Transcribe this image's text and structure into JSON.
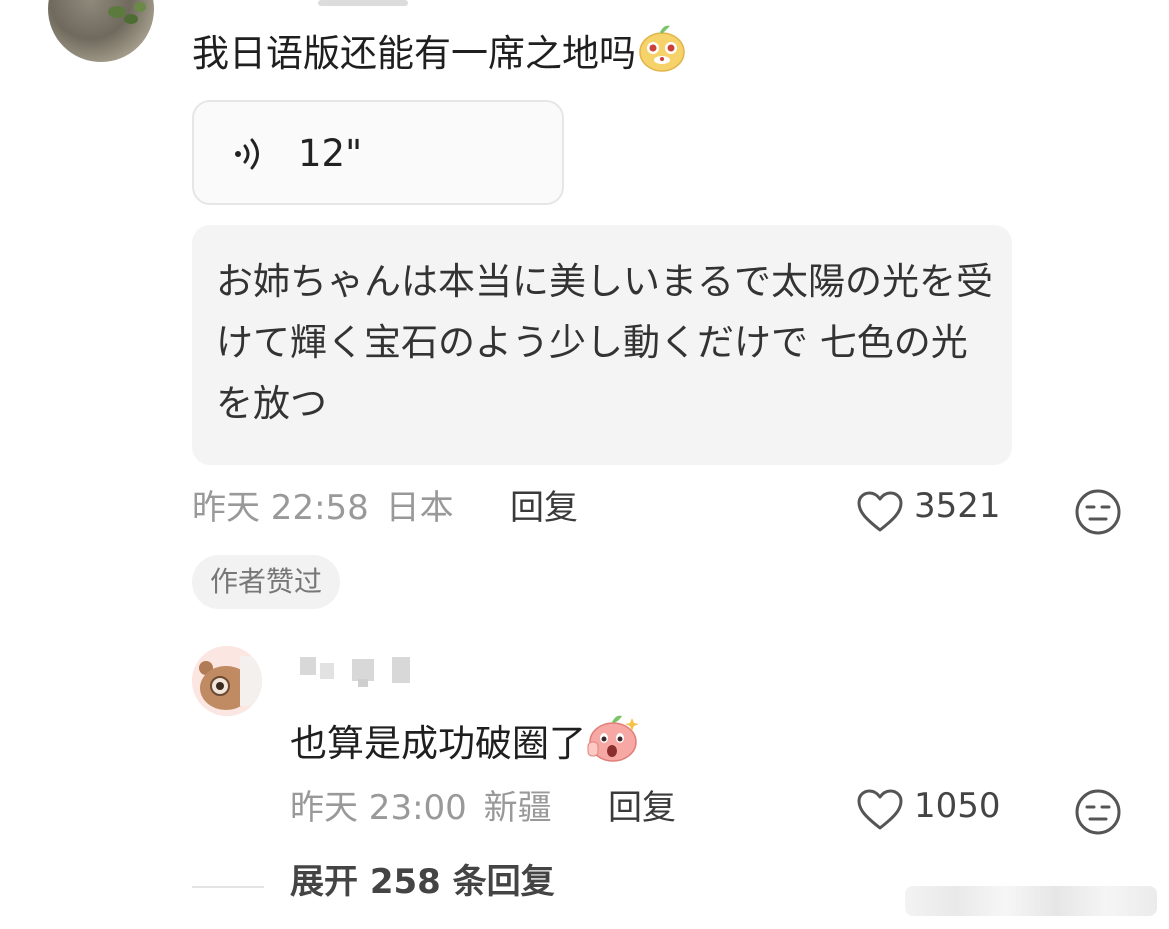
{
  "comment": {
    "text": "我日语版还能有一席之地吗",
    "emoji": "pear-emoji-smug",
    "voice": {
      "duration": "12\""
    },
    "translation": "お姉ちゃんは本当に美しいまるで太陽の光を受けて輝く宝石のよう少し動くだけで 七色の光を放つ",
    "time": "昨天 22:58",
    "location": "日本",
    "reply_label": "回复",
    "likes": "3521",
    "author_tag": "作者赞过"
  },
  "reply": {
    "text": "也算是成功破圈了",
    "emoji": "peach-emoji-shocked",
    "time": "昨天 23:00",
    "location": "新疆",
    "reply_label": "回复",
    "likes": "1050"
  },
  "expand": {
    "label": "展开 258 条回复"
  },
  "icons": {
    "voice": "voice-wave-icon",
    "like": "heart-icon",
    "dislike": "unamused-face-icon"
  },
  "colors": {
    "meta": "#999999",
    "bubble_bg": "#f4f4f4",
    "tag_bg": "#f2f2f2"
  }
}
